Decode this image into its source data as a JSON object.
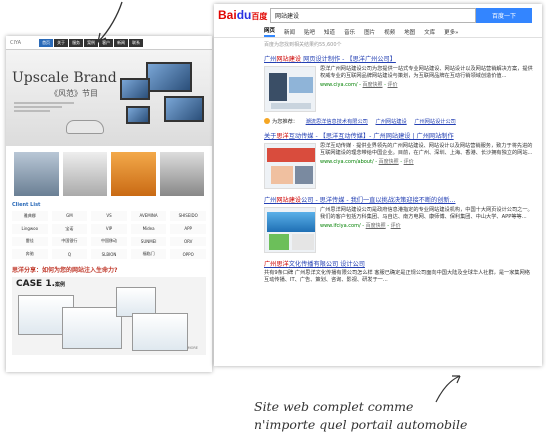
{
  "website": {
    "logo": "CIYA",
    "nav_items": [
      "首页",
      "关于",
      "服务",
      "案例",
      "客户",
      "新闻",
      "联系"
    ],
    "brand_en": "Upscale Brand",
    "brand_cn": "《风范》节目",
    "client_title": "Client List",
    "clients": [
      "雅典娜",
      "GM",
      "VS",
      "AVEMINA",
      "SHISEIDO",
      "Lingwoo",
      "宝诺",
      "VIP",
      "Midea",
      "APP",
      "雷佳",
      "中国银行",
      "中国移动",
      "SUNMEI",
      "ORV",
      "奔驰",
      "Q",
      "SLBION",
      "福临门",
      "OPPO"
    ],
    "think_line": "思洋分享：如何为您的网站注入生命力?",
    "case_label": "CASE 1.",
    "case_sub": "案例",
    "more_label": "MORE"
  },
  "baidu": {
    "logo_text": "Bai",
    "logo_paw": "du",
    "logo_cn": "百度",
    "search_value": "网站建设",
    "search_button": "百度一下",
    "tabs": [
      "网页",
      "新闻",
      "贴吧",
      "知道",
      "音乐",
      "图片",
      "视频",
      "地图",
      "文库",
      "更多»"
    ],
    "active_tab": "网页",
    "result_count": "百度为您找到相关结果约55,600个",
    "results": [
      {
        "title_pre": "广州",
        "title_hl": "网站建设",
        "title_post": " 网页设计制作 - 【思洋广州公司】",
        "desc": "思洋广州网站建设公司为您提供一站式专业网站建设、网站设计以及网站营销解决方案，提供权威专业的互联网品牌网站建设与策划，为互联网品牌在互动行销领域创造价值...",
        "url": "www.ciya.com/",
        "snapshot": "百度快照",
        "review": "评价"
      },
      {
        "title_pre": "关于",
        "title_hl": "思洋",
        "title_post": "互动传媒 - 【思洋互动传媒】- 广州网站建设 | 广州网站制作",
        "desc": "思洋互动传媒 · 提供业界领先的广州网站建设、网站设计以及网站营销服务，致力于将先进的互联网建设的理念带给中国企业。目前，在广州、深圳、上海、香港、长沙拥有独立的网站...",
        "url": "www.ciya.com/about/",
        "snapshot": "百度快照",
        "review": "评价"
      },
      {
        "title_pre": "广州",
        "title_hl": "网站建设",
        "title_post": "公司 - 思洋传媒 - 我们一直以挑战决策迎接不断的创新...",
        "desc": "广州思洋网站建设公司是政府信息港指定的专业网站建设机构，中国十大网页设计公司之一。我们的客户包括万科集团、马自达、南方电网、康师傅、保利集团、中山大学、APP等等...",
        "url": "www.ifciya.com/",
        "snapshot": "百度快照",
        "review": "评价"
      },
      {
        "title_pre": "",
        "title_hl": "广州思洋",
        "title_post": "文化传播有限公司 设计公司",
        "desc": "共有9条口碑 广州思洋文化传播有限公司怎么样 客服已确定是正规公司面向中国大陆及全球华人社群，是一家集网络互动传播、IT、广告、策划、咨询、影视、研发于一...",
        "url": "",
        "snapshot": "",
        "review": ""
      }
    ],
    "recommend": {
      "label": "为您推荐：",
      "links": [
        "潮流思洋信息技术有限公司",
        "广州网站建设",
        "广州网站设计公司"
      ]
    }
  },
  "annotation": {
    "caption_line1": "Site web complet comme",
    "caption_line2": "n'importe quel portail automobile"
  }
}
